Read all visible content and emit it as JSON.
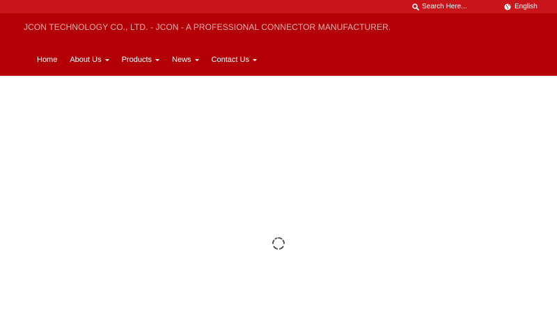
{
  "topbar": {
    "search_placeholder": "Search Here...",
    "language": "English"
  },
  "header": {
    "site_title": "JCON TECHNOLOGY CO., LTD. - JCON - A PROFESSIONAL CONNECTOR MANUFACTURER."
  },
  "nav": {
    "items": [
      {
        "label": "Home",
        "has_dropdown": false
      },
      {
        "label": "About Us",
        "has_dropdown": true
      },
      {
        "label": "Products",
        "has_dropdown": true
      },
      {
        "label": "News",
        "has_dropdown": true
      },
      {
        "label": "Contact Us",
        "has_dropdown": true
      }
    ]
  },
  "colors": {
    "topbar": "#c8141a",
    "header": "#b30006",
    "spinner": "#555555"
  },
  "icons": {
    "search": "search-icon",
    "language": "globe-icon",
    "loading": "loading-spinner-icon"
  }
}
